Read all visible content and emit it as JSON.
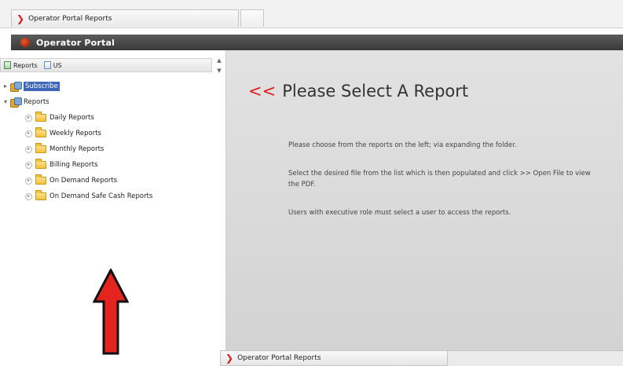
{
  "browser": {
    "tab_title": "Operator Portal Reports"
  },
  "app": {
    "title": "Operator Portal"
  },
  "left_toolbar": {
    "reports_label": "Reports",
    "us_label": "US"
  },
  "tree": {
    "roots": [
      {
        "label": "Subscribe",
        "selected": true
      },
      {
        "label": "Reports",
        "selected": false
      }
    ],
    "children": [
      {
        "label": "Daily Reports"
      },
      {
        "label": "Weekly Reports"
      },
      {
        "label": "Monthly Reports"
      },
      {
        "label": "Billing Reports"
      },
      {
        "label": "On Demand Reports"
      },
      {
        "label": "On Demand Safe Cash Reports"
      }
    ]
  },
  "main": {
    "headline_prefix": "<<",
    "headline": "Please Select A Report",
    "paragraphs": [
      "Please choose from the reports on the left; via expanding the folder.",
      "Select the desired file from the list which is then populated and click >> Open File to view the PDF.",
      "Users with executive role must select a user to access the reports."
    ]
  },
  "taskbar": {
    "tab_title": "Operator Portal Reports"
  },
  "colors": {
    "accent_red": "#e01f1f",
    "title_bar": "#3a3a3a",
    "selection": "#3f66b8",
    "content_bg": "#d9d9d9"
  }
}
